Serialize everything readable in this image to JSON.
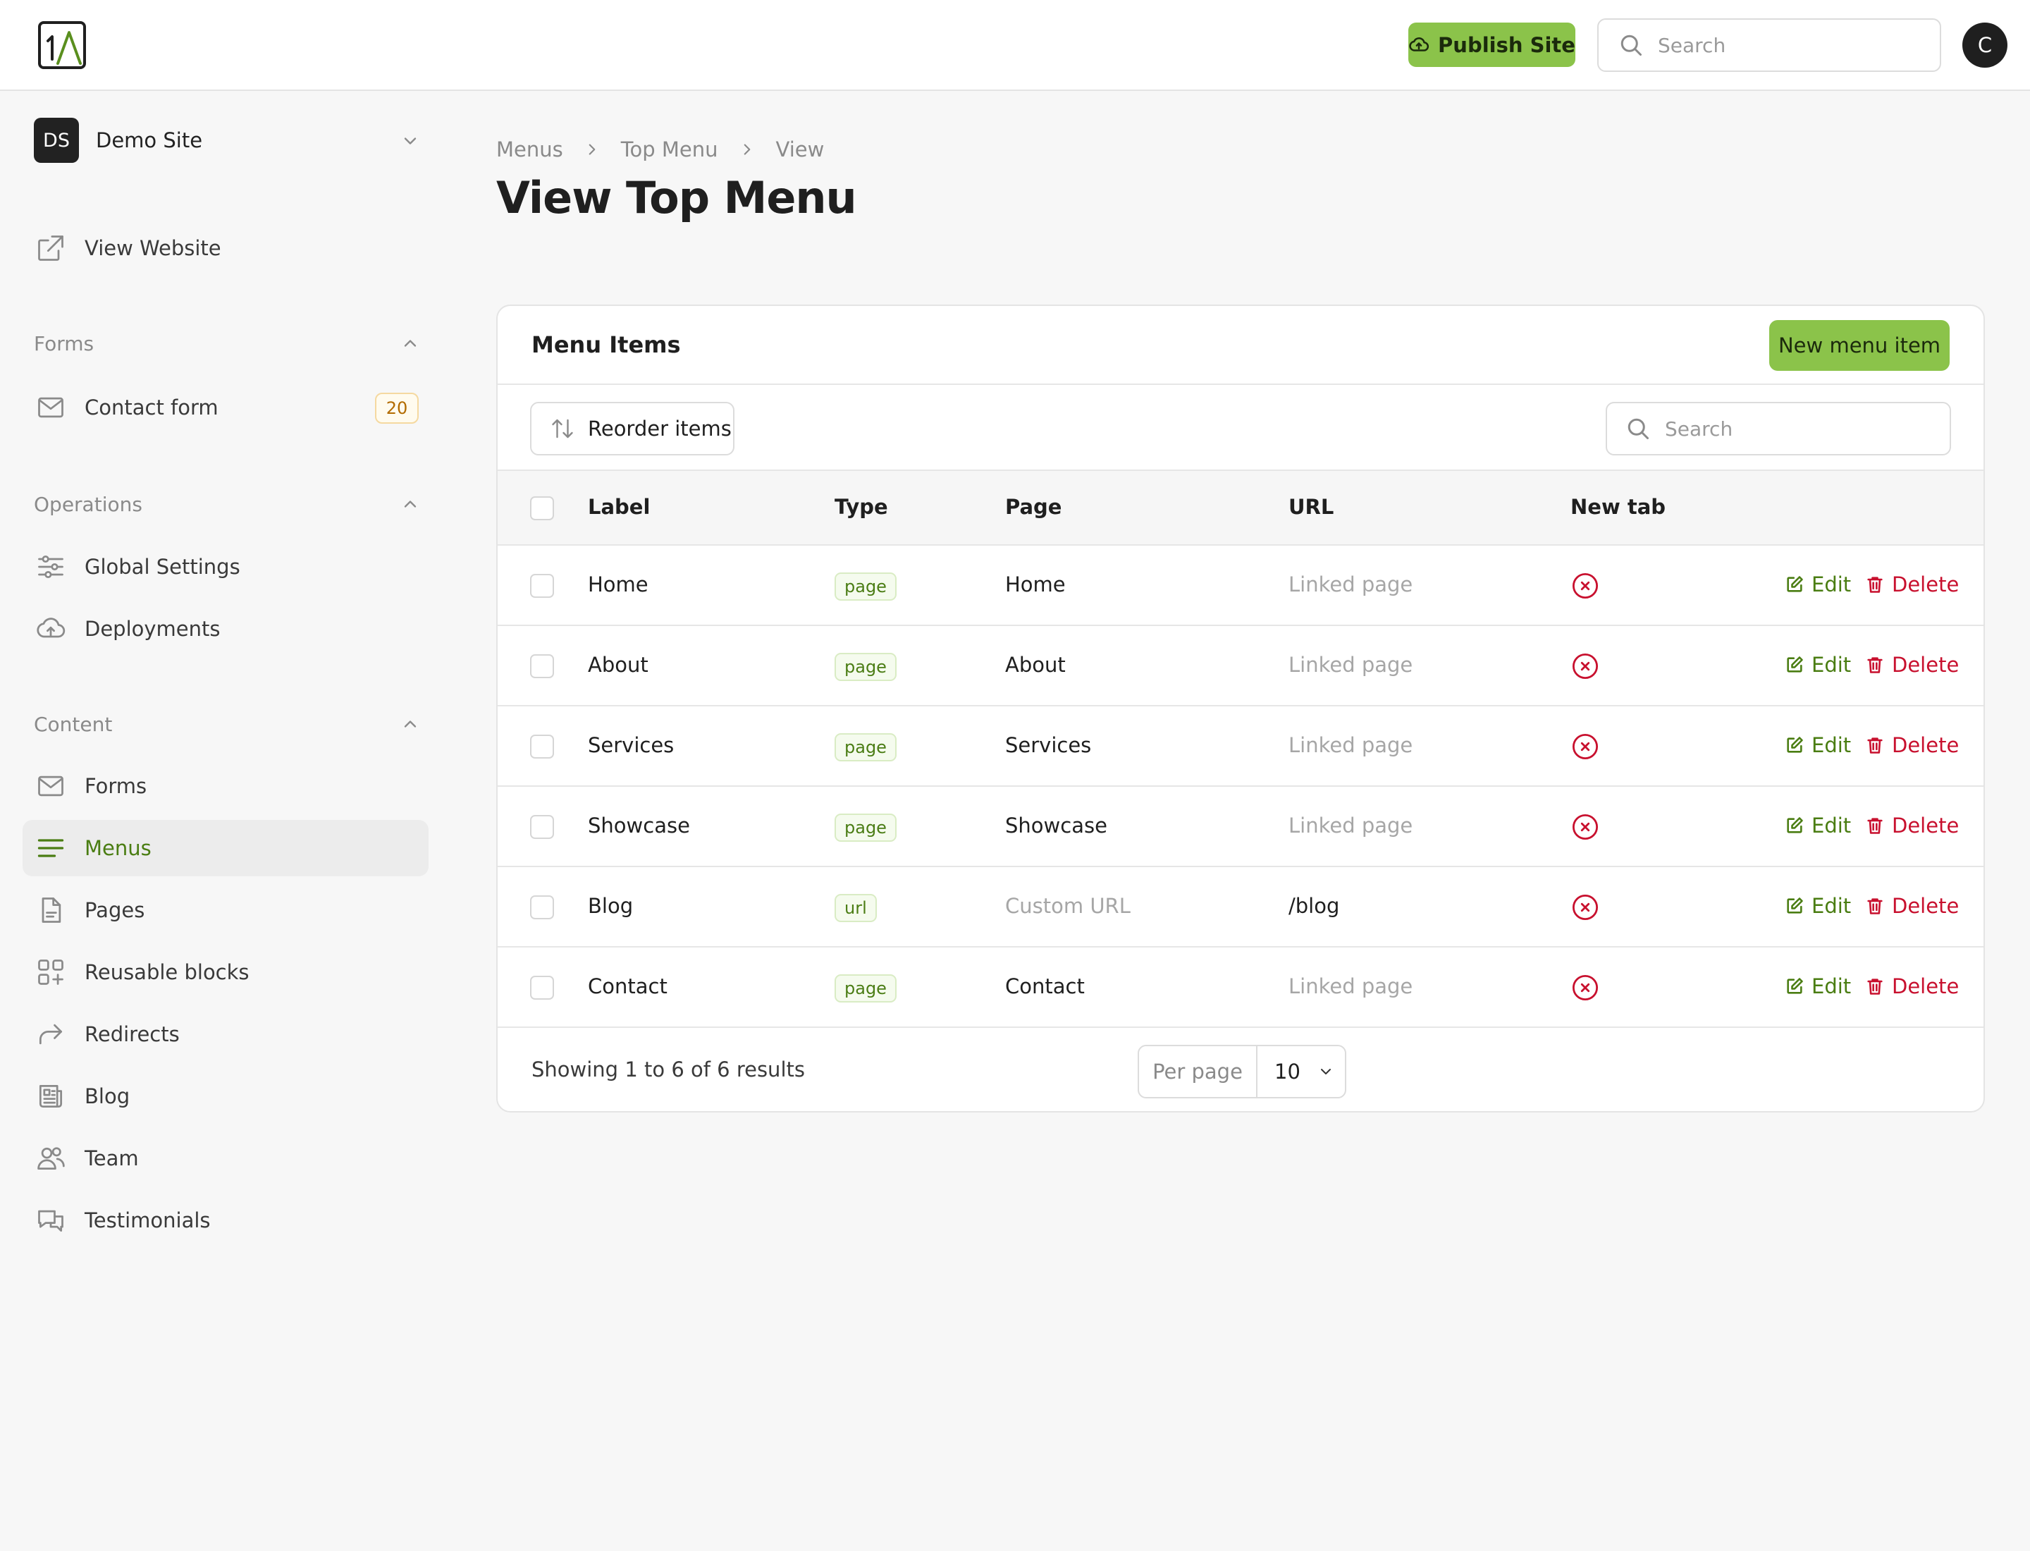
{
  "header": {
    "publish_label": "Publish Site",
    "search_placeholder": "Search",
    "avatar_initial": "C",
    "colors": {
      "accent": "#8bc34a",
      "danger": "#c8102e",
      "active_text": "#4a7d12"
    }
  },
  "sidebar": {
    "site": {
      "initials": "DS",
      "name": "Demo Site"
    },
    "view_website": "View Website",
    "groups": {
      "forms": {
        "label": "Forms",
        "items": [
          {
            "label": "Contact form",
            "badge": "20",
            "icon": "mail-icon"
          }
        ]
      },
      "operations": {
        "label": "Operations",
        "items": [
          {
            "label": "Global Settings",
            "icon": "sliders-icon"
          },
          {
            "label": "Deployments",
            "icon": "cloud-upload-icon"
          }
        ]
      },
      "content": {
        "label": "Content",
        "items": [
          {
            "label": "Forms",
            "icon": "mail-icon"
          },
          {
            "label": "Menus",
            "icon": "menu-lines-icon",
            "active": true
          },
          {
            "label": "Pages",
            "icon": "document-icon"
          },
          {
            "label": "Reusable blocks",
            "icon": "blocks-icon"
          },
          {
            "label": "Redirects",
            "icon": "redirect-arrow-icon"
          },
          {
            "label": "Blog",
            "icon": "newspaper-icon"
          },
          {
            "label": "Team",
            "icon": "users-icon"
          },
          {
            "label": "Testimonials",
            "icon": "chat-bubbles-icon"
          }
        ]
      }
    }
  },
  "page": {
    "breadcrumb": [
      "Menus",
      "Top Menu",
      "View"
    ],
    "title": "View Top Menu"
  },
  "card": {
    "title": "Menu Items",
    "new_button": "New menu item",
    "reorder_button": "Reorder items",
    "search_placeholder": "Search",
    "columns": [
      "Label",
      "Type",
      "Page",
      "URL",
      "New tab"
    ],
    "rows": [
      {
        "label": "Home",
        "type": "page",
        "page": "Home",
        "url": "Linked page",
        "url_muted": true,
        "page_muted": false,
        "new_tab": false
      },
      {
        "label": "About",
        "type": "page",
        "page": "About",
        "url": "Linked page",
        "url_muted": true,
        "page_muted": false,
        "new_tab": false
      },
      {
        "label": "Services",
        "type": "page",
        "page": "Services",
        "url": "Linked page",
        "url_muted": true,
        "page_muted": false,
        "new_tab": false
      },
      {
        "label": "Showcase",
        "type": "page",
        "page": "Showcase",
        "url": "Linked page",
        "url_muted": true,
        "page_muted": false,
        "new_tab": false
      },
      {
        "label": "Blog",
        "type": "url",
        "page": "Custom URL",
        "url": "/blog",
        "url_muted": false,
        "page_muted": true,
        "new_tab": false
      },
      {
        "label": "Contact",
        "type": "page",
        "page": "Contact",
        "url": "Linked page",
        "url_muted": true,
        "page_muted": false,
        "new_tab": false
      }
    ],
    "edit_label": "Edit",
    "delete_label": "Delete",
    "footer": {
      "results_text": "Showing 1 to 6 of 6 results",
      "per_page_label": "Per page",
      "per_page_value": "10"
    }
  }
}
